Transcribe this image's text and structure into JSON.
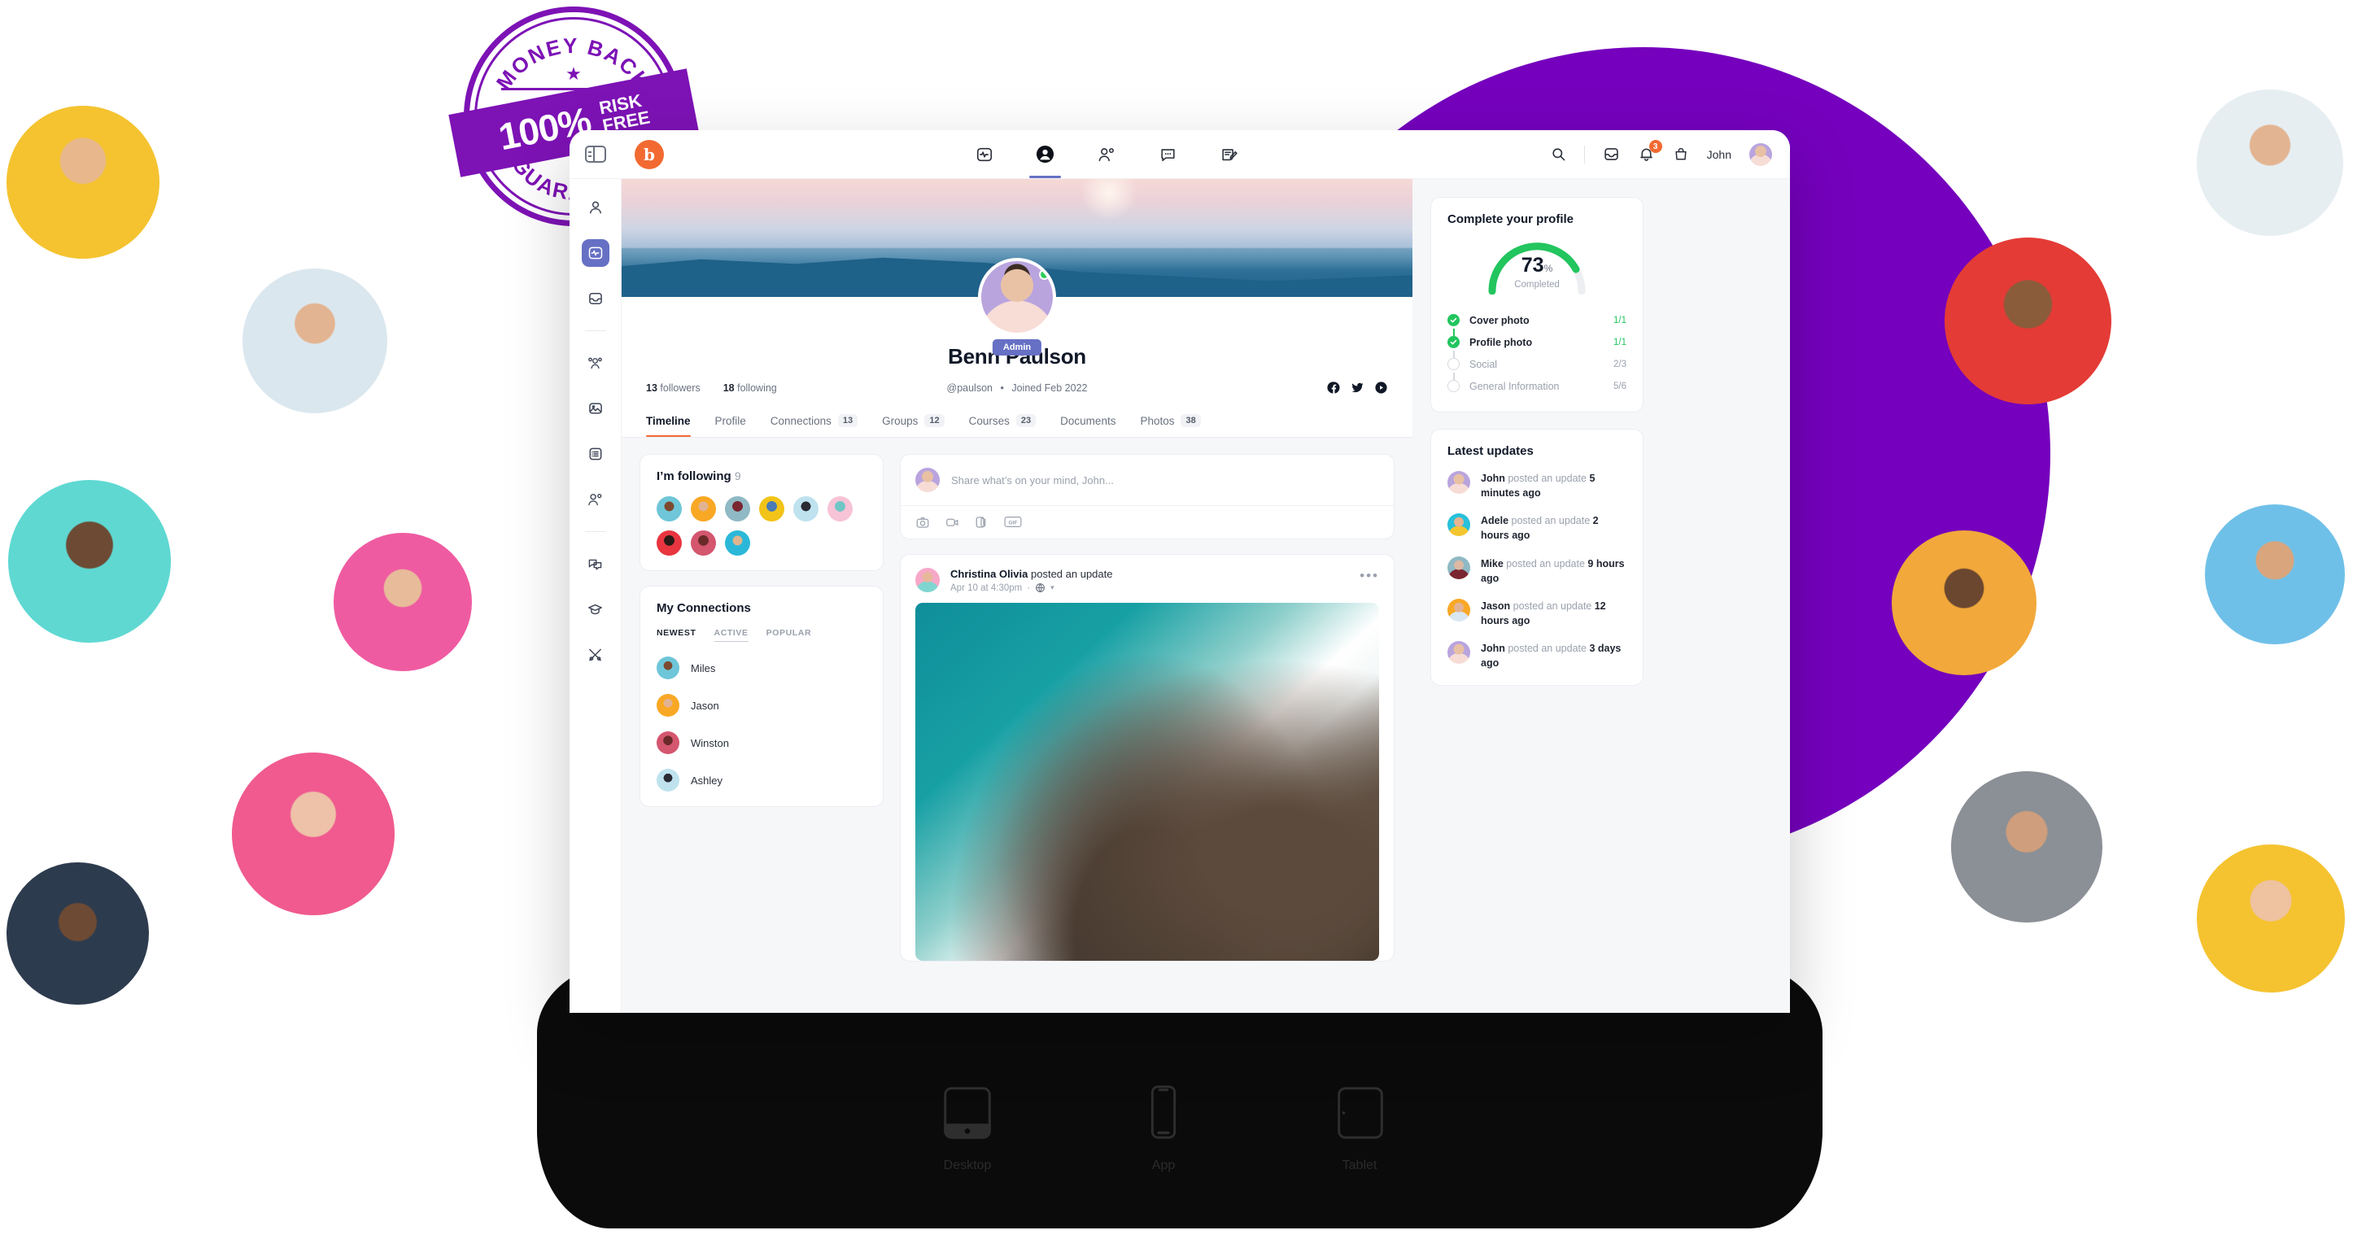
{
  "promo_stamp": {
    "top_text": "MONEY BACK",
    "bottom_text": "GUARANTEE",
    "percent": "100%",
    "risk": "RISK",
    "free": "FREE",
    "star": "★",
    "color": "#7d12b5"
  },
  "window": {
    "topbar": {
      "panel_toggle": "panel-toggle",
      "brand": "b",
      "nav": [
        {
          "name": "activity",
          "icon": "pulse-icon",
          "active": false
        },
        {
          "name": "profile",
          "icon": "user-filled-icon",
          "active": true
        },
        {
          "name": "members",
          "icon": "people-icon",
          "active": false
        },
        {
          "name": "messages",
          "icon": "chat-icon",
          "active": false
        },
        {
          "name": "forums",
          "icon": "note-edit-icon",
          "active": false
        }
      ],
      "search_icon": "search-icon",
      "inbox_icon": "inbox-icon",
      "notifications_icon": "bell-icon",
      "notifications_count": "3",
      "cart_icon": "bag-icon",
      "username": "John"
    },
    "rail": [
      {
        "name": "profile",
        "icon": "user-icon",
        "active": false
      },
      {
        "name": "activity",
        "icon": "pulse-icon",
        "active": true
      },
      {
        "name": "inbox",
        "icon": "inbox-icon",
        "active": false
      },
      {
        "name": "groups",
        "icon": "people-group-icon",
        "active": false
      },
      {
        "name": "media",
        "icon": "image-icon",
        "active": false
      },
      {
        "name": "documents",
        "icon": "list-icon",
        "active": false
      },
      {
        "name": "connections",
        "icon": "people-icon",
        "active": false
      },
      {
        "name": "messages",
        "icon": "chat-bubbles-icon",
        "active": false
      },
      {
        "name": "courses",
        "icon": "graduation-cap-icon",
        "active": false
      },
      {
        "name": "settings",
        "icon": "tools-icon",
        "active": false
      }
    ],
    "profile": {
      "name": "Benn Paulson",
      "badge": "Admin",
      "followers_count": "13",
      "followers_label": "followers",
      "following_count": "18",
      "following_label": "following",
      "handle": "@paulson",
      "separator": "•",
      "joined": "Joined Feb 2022",
      "socials": [
        "facebook-icon",
        "twitter-icon",
        "youtube-icon"
      ]
    },
    "tabs": [
      {
        "label": "Timeline",
        "count": "",
        "active": true
      },
      {
        "label": "Profile",
        "count": "",
        "active": false
      },
      {
        "label": "Connections",
        "count": "13",
        "active": false
      },
      {
        "label": "Groups",
        "count": "12",
        "active": false
      },
      {
        "label": "Courses",
        "count": "23",
        "active": false
      },
      {
        "label": "Documents",
        "count": "",
        "active": false
      },
      {
        "label": "Photos",
        "count": "38",
        "active": false
      }
    ],
    "following_card": {
      "title": "I’m following",
      "count": "9",
      "avatars": [
        "#6ec6d8",
        "#f9a825",
        "#8fb9c4",
        "#f2c318",
        "#bfe2ef",
        "#f7c3d6",
        "#e8353f",
        "#d4566f",
        "#2bb8d8"
      ]
    },
    "connections_card": {
      "title": "My Connections",
      "filters": [
        {
          "label": "NEWEST",
          "active": true
        },
        {
          "label": "ACTIVE",
          "active": false
        },
        {
          "label": "POPULAR",
          "active": false
        }
      ],
      "people": [
        {
          "name": "Miles",
          "color": "#6ec6d8"
        },
        {
          "name": "Jason",
          "color": "#f9a825"
        },
        {
          "name": "Winston",
          "color": "#d4566f"
        },
        {
          "name": "Ashley",
          "color": "#bfe2ef"
        }
      ]
    },
    "composer": {
      "placeholder": "Share what’s on your mind, John...",
      "actions": [
        "camera-icon",
        "video-icon",
        "attachment-icon",
        "gif-icon"
      ]
    },
    "post": {
      "author": "Christina Olivia",
      "action": "posted an update",
      "time": "Apr 10 at 4:30pm",
      "separator": "·",
      "privacy_icon": "globe-icon",
      "caret": "▾",
      "more": "•••",
      "image": "ocean-rocks-photo"
    },
    "complete_profile": {
      "title": "Complete your profile",
      "percent": "73",
      "percent_symbol": "%",
      "completed_label": "Completed",
      "gauge_color": "#22c55e",
      "track_color": "#eceef1",
      "steps": [
        {
          "label": "Cover photo",
          "count": "1/1",
          "done": true
        },
        {
          "label": "Profile photo",
          "count": "1/1",
          "done": true
        },
        {
          "label": "Social",
          "count": "2/3",
          "done": false
        },
        {
          "label": "General Information",
          "count": "5/6",
          "done": false
        }
      ]
    },
    "latest_updates": {
      "title": "Latest updates",
      "items": [
        {
          "name": "John",
          "action": "posted an update",
          "time": "5 minutes ago",
          "color": "#b9a4de"
        },
        {
          "name": "Adele",
          "action": "posted an update",
          "time": "2 hours ago",
          "color": "#29c0da"
        },
        {
          "name": "Mike",
          "action": "posted an update",
          "time": "9 hours ago",
          "color": "#8fb9c4"
        },
        {
          "name": "Jason",
          "action": "posted an update",
          "time": "12 hours ago",
          "color": "#f9a825"
        },
        {
          "name": "John",
          "action": "posted an update",
          "time": "3 days ago",
          "color": "#b9a4de"
        }
      ]
    }
  },
  "devices": [
    {
      "label": "Desktop",
      "icon": "desktop-icon",
      "active": true
    },
    {
      "label": "App",
      "icon": "phone-icon",
      "active": false
    },
    {
      "label": "Tablet",
      "icon": "tablet-icon",
      "active": false
    }
  ],
  "background_avatars": [
    {
      "name": "avatar-1",
      "color": "#f5c330"
    },
    {
      "name": "avatar-2",
      "color": "#dbe7ee"
    },
    {
      "name": "avatar-3",
      "color": "#5fd8d2"
    },
    {
      "name": "avatar-4",
      "color": "#ef5ba1"
    },
    {
      "name": "avatar-5",
      "color": "#f05a8f"
    },
    {
      "name": "avatar-6",
      "color": "#2d3b4e"
    },
    {
      "name": "avatar-7",
      "color": "#e6eef2"
    },
    {
      "name": "avatar-8",
      "color": "#e43b36"
    },
    {
      "name": "avatar-9",
      "color": "#f2a83a"
    },
    {
      "name": "avatar-10",
      "color": "#6fc0e8"
    },
    {
      "name": "avatar-11",
      "color": "#8b8f96"
    },
    {
      "name": "avatar-12",
      "color": "#f5c330"
    }
  ]
}
